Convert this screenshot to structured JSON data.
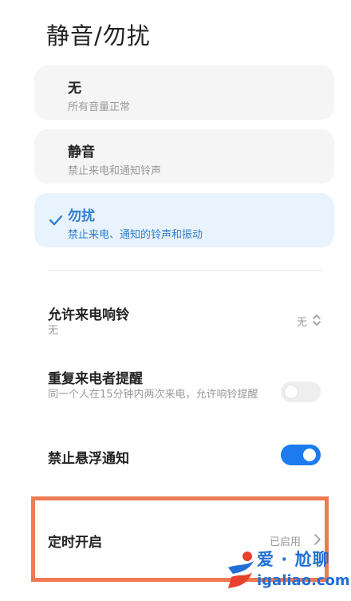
{
  "page": {
    "title": "静音/勿扰"
  },
  "modes": [
    {
      "title": "无",
      "subtitle": "所有音量正常"
    },
    {
      "title": "静音",
      "subtitle": "禁止来电和通知铃声"
    },
    {
      "title": "勿扰",
      "subtitle": "禁止来电、通知的铃声和振动",
      "selected": true
    }
  ],
  "settings": {
    "allow_ringing": {
      "title": "允许来电响铃",
      "subtitle": "无",
      "value": "无"
    },
    "repeat_caller": {
      "title": "重复来电者提醒",
      "subtitle": "同一个人在15分钟内两次来电，允许响铃提醒",
      "enabled": false
    },
    "block_floating": {
      "title": "禁止悬浮通知",
      "enabled": true
    },
    "schedule": {
      "title": "定时开启",
      "value": "已启用"
    }
  },
  "watermark": {
    "brand": "爱 · 尬聊",
    "domain": "igaliao.com"
  },
  "colors": {
    "accent": "#1c7bee",
    "selected_text": "#2f7fd0",
    "highlight": "#ee7a52"
  }
}
